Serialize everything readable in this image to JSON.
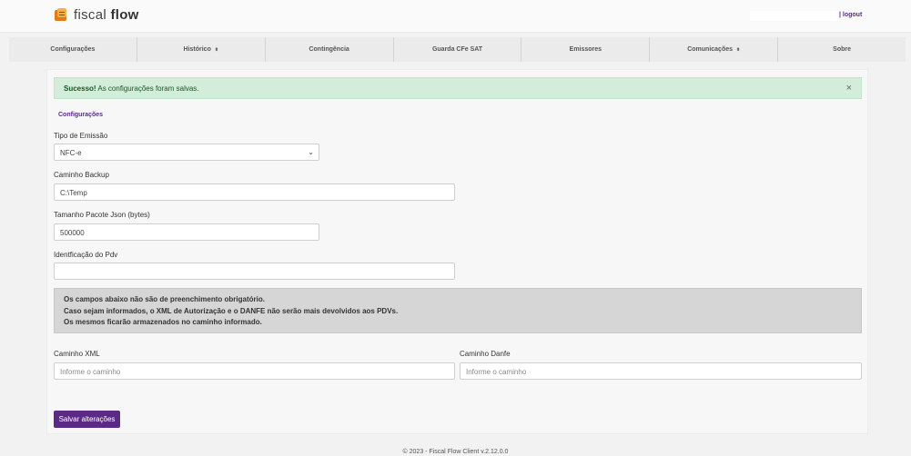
{
  "header": {
    "brand_light": "fiscal ",
    "brand_bold": "flow",
    "logout": "| logout"
  },
  "nav": [
    {
      "label": "Configurações",
      "caret": ""
    },
    {
      "label": "Histórico",
      "caret": "⬍"
    },
    {
      "label": "Contingência",
      "caret": ""
    },
    {
      "label": "Guarda CFe SAT",
      "caret": ""
    },
    {
      "label": "Emissores",
      "caret": ""
    },
    {
      "label": "Comunicações",
      "caret": "⬍"
    },
    {
      "label": "Sobre",
      "caret": ""
    }
  ],
  "alert": {
    "strong": "Sucesso!",
    "message": " As configurações foram salvas.",
    "close": "×"
  },
  "section_title": "Configurações",
  "form": {
    "tipo_emissao": {
      "label": "Tipo de Emissão",
      "value": "NFC-e"
    },
    "caminho_backup": {
      "label": "Caminho Backup",
      "value": "C:\\Temp"
    },
    "tamanho_pacote": {
      "label": "Tamanho Pacote Json (bytes)",
      "value": "500000"
    },
    "identificacao_pdv": {
      "label": "Identficação do Pdv",
      "value": ""
    },
    "caminho_xml": {
      "label": "Caminho XML",
      "placeholder": "Informe o caminho"
    },
    "caminho_danfe": {
      "label": "Caminho Danfe",
      "placeholder": "Informe o caminho"
    }
  },
  "info": {
    "line1": "Os campos abaixo não são de preenchimento obrigatório.",
    "line2": "Caso sejam informados, o XML de Autorização e o DANFE não serão mais devolvidos aos PDVs.",
    "line3": "Os mesmos ficarão armazenados no caminho informado."
  },
  "save_button": "Salvar alterações",
  "footer": "© 2023 - Fiscal Flow Client v.2.12.0.0"
}
